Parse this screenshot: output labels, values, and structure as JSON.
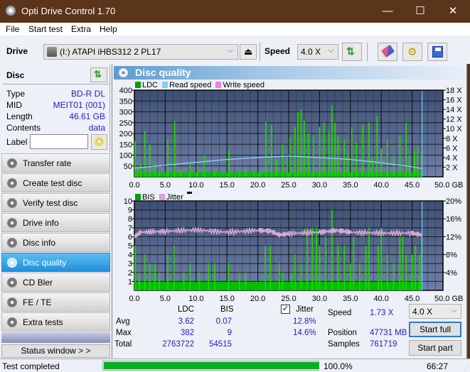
{
  "window": {
    "title": "Opti Drive Control 1.70",
    "minimize": "—",
    "maximize": "☐",
    "close": "✕"
  },
  "menu": [
    "File",
    "Start test",
    "Extra",
    "Help"
  ],
  "toolbar": {
    "drive_label": "Drive",
    "drive_value": "(I:)  ATAPI iHBS312   2 PL17",
    "speed_label": "Speed",
    "speed_value": "4.0 X",
    "icons": [
      "eject-icon",
      "refresh-icon",
      "erase-icon",
      "settings-icon",
      "save-icon"
    ]
  },
  "disc": {
    "title": "Disc",
    "fields": [
      {
        "key": "Type",
        "value": "BD-R DL"
      },
      {
        "key": "MID",
        "value": "MEIT01 (001)"
      },
      {
        "key": "Length",
        "value": "46.61 GB"
      },
      {
        "key": "Contents",
        "value": "data"
      }
    ],
    "label_key": "Label",
    "label_value": ""
  },
  "nav": [
    {
      "label": "Transfer rate",
      "active": false
    },
    {
      "label": "Create test disc",
      "active": false
    },
    {
      "label": "Verify test disc",
      "active": false
    },
    {
      "label": "Drive info",
      "active": false
    },
    {
      "label": "Disc info",
      "active": false
    },
    {
      "label": "Disc quality",
      "active": true
    },
    {
      "label": "CD Bler",
      "active": false
    },
    {
      "label": "FE / TE",
      "active": false
    },
    {
      "label": "Extra tests",
      "active": false
    }
  ],
  "status_window_btn": "Status window > >",
  "panel_title": "Disc quality",
  "chart_data": [
    {
      "type": "bar",
      "title": "LDC / Read speed",
      "legend": [
        {
          "name": "LDC",
          "color": "#00a000"
        },
        {
          "name": "Read speed",
          "color": "#88ccf5"
        },
        {
          "name": "Write speed",
          "color": "#f07cf0"
        }
      ],
      "x_ticks": [
        "0.0",
        "5.0",
        "10.0",
        "15.0",
        "20.0",
        "25.0",
        "30.0",
        "35.0",
        "40.0",
        "45.0",
        "50.0 GB"
      ],
      "xlim": [
        0,
        50
      ],
      "y_left_ticks": [
        "50",
        "100",
        "150",
        "200",
        "250",
        "300",
        "350",
        "400"
      ],
      "ylim_left": [
        0,
        400
      ],
      "y_right_ticks": [
        "2 X",
        "4 X",
        "6 X",
        "8 X",
        "10 X",
        "12 X",
        "14 X",
        "16 X",
        "18 X"
      ],
      "ylim_right": [
        0,
        18
      ],
      "grid": true,
      "disc_end_gb": 46.61,
      "ldc_spikes": [
        [
          0.1,
          165
        ],
        [
          0.5,
          40
        ],
        [
          1.0,
          60
        ],
        [
          1.7,
          210
        ],
        [
          2.5,
          150
        ],
        [
          3.3,
          60
        ],
        [
          4.0,
          20
        ],
        [
          5.4,
          175
        ],
        [
          6.5,
          255
        ],
        [
          7.5,
          30
        ],
        [
          9.0,
          60
        ],
        [
          10.2,
          50
        ],
        [
          11.3,
          100
        ],
        [
          13.0,
          30
        ],
        [
          15.3,
          120
        ],
        [
          17.0,
          30
        ],
        [
          18.0,
          35
        ],
        [
          19.4,
          30
        ],
        [
          20.3,
          30
        ],
        [
          21.3,
          255
        ],
        [
          22.2,
          240
        ],
        [
          23.0,
          80
        ],
        [
          24.0,
          150
        ],
        [
          24.8,
          90
        ],
        [
          25.2,
          180
        ],
        [
          26.0,
          230
        ],
        [
          26.5,
          300
        ],
        [
          27.0,
          310
        ],
        [
          27.5,
          260
        ],
        [
          28.2,
          200
        ],
        [
          29.0,
          190
        ],
        [
          30.0,
          230
        ],
        [
          30.7,
          250
        ],
        [
          31.5,
          210
        ],
        [
          32.0,
          330
        ],
        [
          32.5,
          250
        ],
        [
          33.0,
          190
        ],
        [
          34.0,
          170
        ],
        [
          34.6,
          110
        ],
        [
          35.2,
          230
        ],
        [
          36.0,
          160
        ],
        [
          37.0,
          240
        ],
        [
          38.0,
          250
        ],
        [
          38.6,
          90
        ],
        [
          39.3,
          280
        ],
        [
          40.0,
          130
        ],
        [
          41.0,
          170
        ],
        [
          42.0,
          100
        ],
        [
          43.0,
          190
        ],
        [
          44.0,
          250
        ],
        [
          44.6,
          100
        ],
        [
          45.4,
          120
        ],
        [
          45.9,
          140
        ],
        [
          46.5,
          100
        ]
      ],
      "read_speed": [
        [
          0,
          1.8
        ],
        [
          5,
          2.4
        ],
        [
          10,
          3.0
        ],
        [
          15,
          3.6
        ],
        [
          20,
          4.0
        ],
        [
          25,
          4.3
        ],
        [
          30,
          4.0
        ],
        [
          35,
          3.6
        ],
        [
          40,
          2.9
        ],
        [
          45,
          2.1
        ],
        [
          46.6,
          1.7
        ]
      ]
    },
    {
      "type": "bar",
      "title": "BIS / Jitter",
      "legend": [
        {
          "name": "BIS",
          "color": "#00a000"
        },
        {
          "name": "Jitter",
          "color": "#d8a0d8"
        }
      ],
      "x_ticks": [
        "0.0",
        "5.0",
        "10.0",
        "15.0",
        "20.0",
        "25.0",
        "30.0",
        "35.0",
        "40.0",
        "45.0",
        "50.0 GB"
      ],
      "xlim": [
        0,
        50
      ],
      "y_left_ticks": [
        "1",
        "2",
        "3",
        "4",
        "5",
        "6",
        "7",
        "8",
        "9",
        "10"
      ],
      "ylim_left": [
        0,
        10
      ],
      "y_right_ticks": [
        "4%",
        "8%",
        "12%",
        "16%",
        "20%"
      ],
      "ylim_right": [
        0,
        20
      ],
      "grid": true,
      "disc_end_gb": 46.61,
      "bis_spikes": [
        [
          0.1,
          5
        ],
        [
          0.8,
          2
        ],
        [
          1.7,
          4
        ],
        [
          2.5,
          3
        ],
        [
          3.3,
          3
        ],
        [
          4.0,
          2
        ],
        [
          5.4,
          4
        ],
        [
          6.4,
          5
        ],
        [
          8.0,
          2
        ],
        [
          9.0,
          3
        ],
        [
          10.5,
          2
        ],
        [
          12.0,
          3
        ],
        [
          13.0,
          3
        ],
        [
          15.2,
          3
        ],
        [
          17.0,
          2
        ],
        [
          18.0,
          2
        ],
        [
          21.2,
          5
        ],
        [
          22.0,
          5
        ],
        [
          23.5,
          3
        ],
        [
          24.0,
          2
        ],
        [
          25.5,
          2
        ],
        [
          26.0,
          4
        ],
        [
          27.0,
          3
        ],
        [
          28.0,
          7
        ],
        [
          28.8,
          7
        ],
        [
          29.5,
          7
        ],
        [
          30.0,
          5
        ],
        [
          31.0,
          6
        ],
        [
          32.0,
          9
        ],
        [
          33.0,
          5
        ],
        [
          34.0,
          5
        ],
        [
          35.0,
          3
        ],
        [
          35.5,
          6
        ],
        [
          36.5,
          3
        ],
        [
          37.5,
          5
        ],
        [
          38.0,
          7
        ],
        [
          39.5,
          5
        ],
        [
          40.0,
          7
        ],
        [
          41.0,
          4
        ],
        [
          42.0,
          3
        ],
        [
          43.0,
          6
        ],
        [
          43.5,
          6
        ],
        [
          44.0,
          4
        ],
        [
          45.0,
          4
        ],
        [
          45.5,
          5
        ],
        [
          46.2,
          4
        ],
        [
          46.5,
          6
        ]
      ],
      "jitter": [
        [
          0,
          12.0
        ],
        [
          1,
          13.0
        ],
        [
          5,
          13.2
        ],
        [
          10,
          13.5
        ],
        [
          15,
          13.0
        ],
        [
          20,
          13.4
        ],
        [
          22,
          13.3
        ],
        [
          23.5,
          12.4
        ],
        [
          25,
          12.7
        ],
        [
          30,
          13.0
        ],
        [
          33,
          13.4
        ],
        [
          35,
          13.0
        ],
        [
          40,
          12.8
        ],
        [
          45,
          12.8
        ],
        [
          46.6,
          12.4
        ]
      ]
    }
  ],
  "stats": {
    "col_ldc": "LDC",
    "col_bis": "BIS",
    "rows": [
      {
        "label": "Avg",
        "ldc": "3.62",
        "bis": "0.07",
        "jitter": "12.8%"
      },
      {
        "label": "Max",
        "ldc": "382",
        "bis": "9",
        "jitter": "14.6%"
      },
      {
        "label": "Total",
        "ldc": "2763722",
        "bis": "54515"
      }
    ],
    "jitter_label": "Jitter",
    "jitter_checked": true,
    "speed_label": "Speed",
    "speed_value": "1.73 X",
    "position_label": "Position",
    "position_value": "47731 MB",
    "samples_label": "Samples",
    "samples_value": "761719",
    "speed_select": "4.0 X",
    "start_full": "Start full",
    "start_part": "Start part"
  },
  "statusbar": {
    "text": "Test completed",
    "progress": 100.0,
    "progress_text": "100.0%",
    "time": "66:27"
  }
}
